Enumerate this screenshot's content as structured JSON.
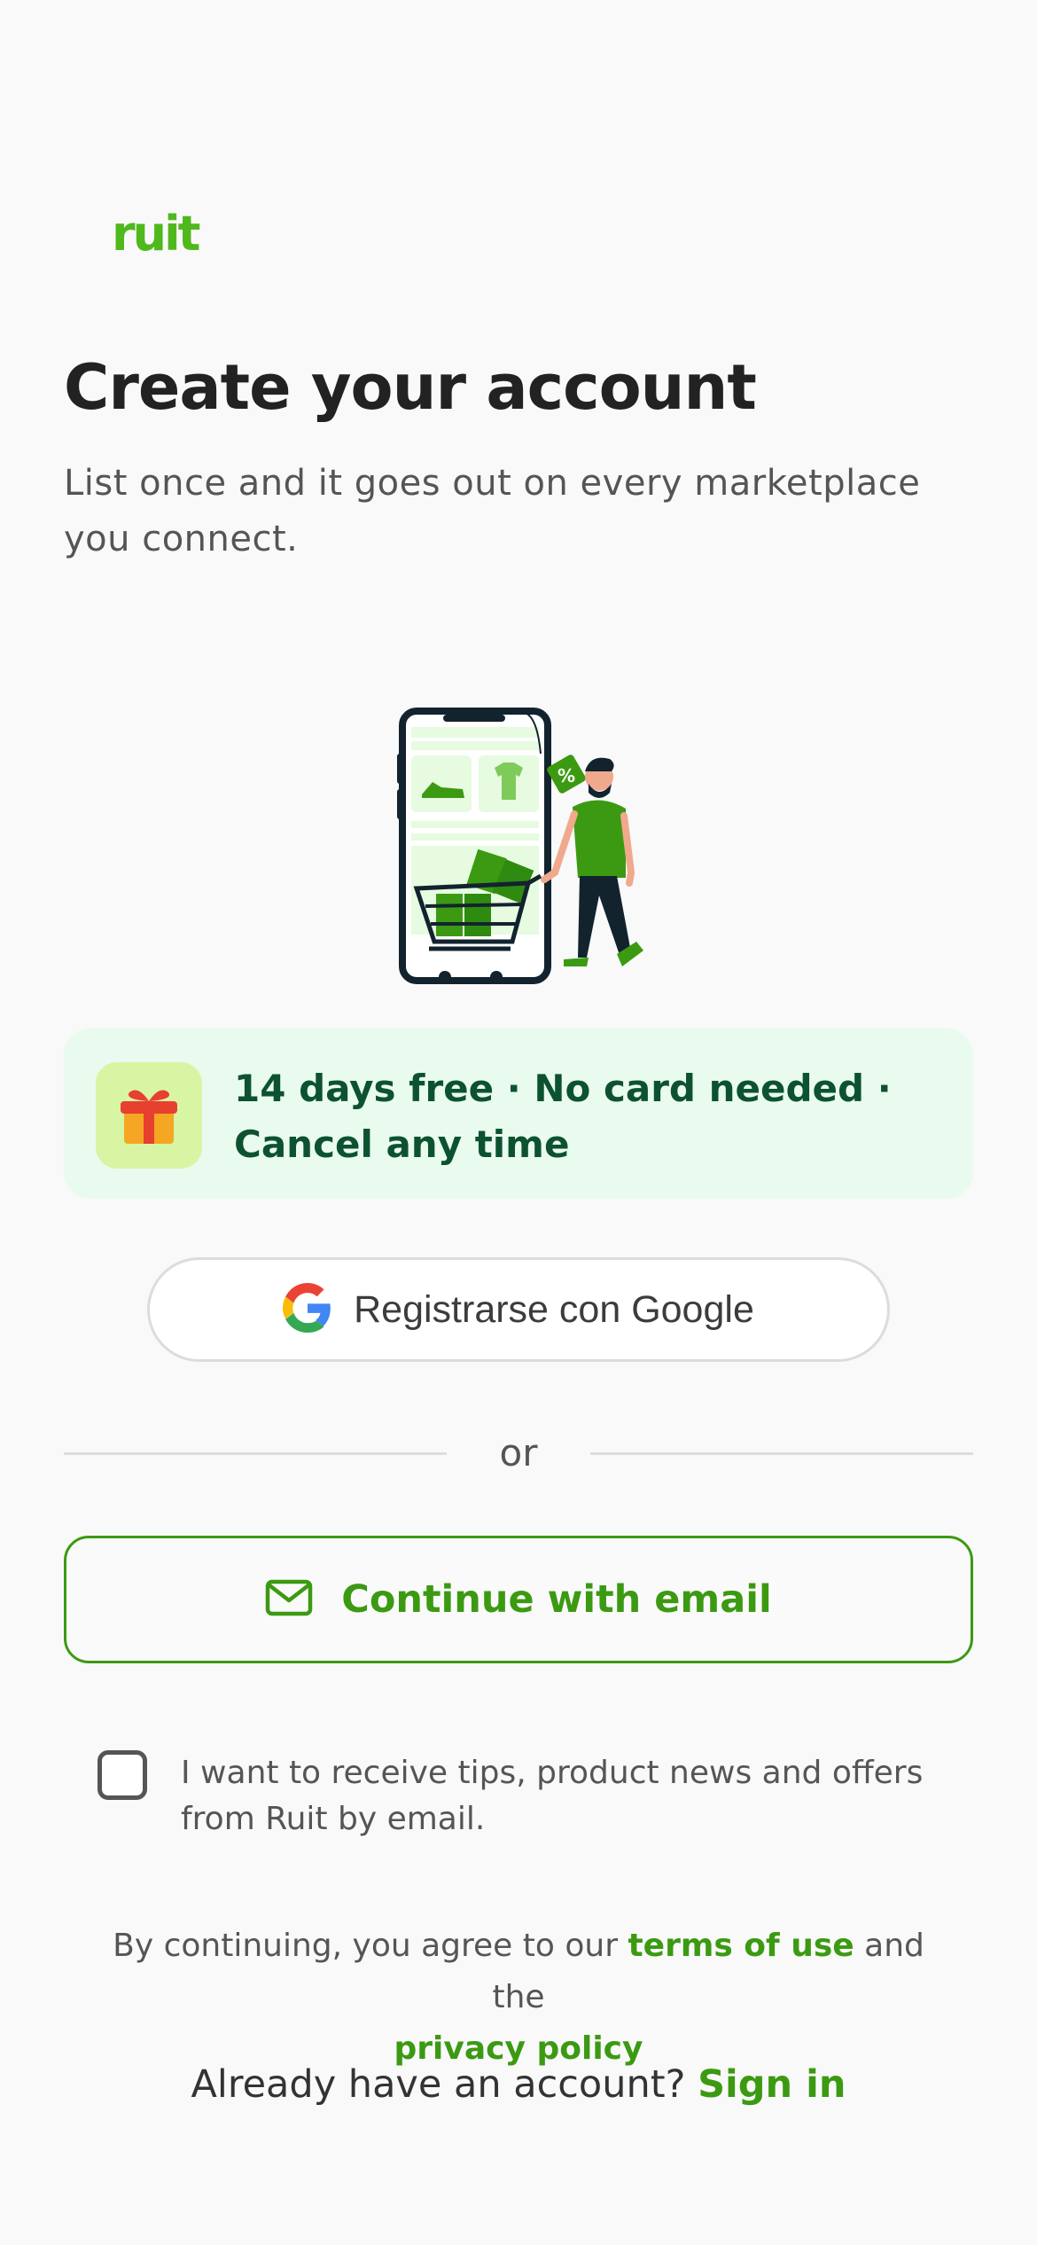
{
  "brand": {
    "logo_text": "ruit",
    "accent_color": "#3b9a12",
    "logo_color": "#4fb81c"
  },
  "header": {
    "title": "Create your account",
    "subtitle": "List once and it goes out on every marketplace you connect."
  },
  "illustration": {
    "icon": "shopping-illustration",
    "badge_text": "%"
  },
  "promo": {
    "icon": "gift-icon",
    "text": "14 days free · No card needed · Cancel any time"
  },
  "google_button": {
    "icon": "google-icon",
    "label": "Registrarse con Google"
  },
  "divider": {
    "text": "or"
  },
  "email_button": {
    "icon": "mail-icon",
    "label": "Continue with email"
  },
  "newsletter": {
    "checked": false,
    "label": "I want to receive tips, product news and offers from Ruit by email."
  },
  "legal": {
    "prefix": "By continuing, you agree to our ",
    "terms_link": "terms of use",
    "middle": " and the ",
    "privacy_link": "privacy policy"
  },
  "signin": {
    "prompt": "Already have an account? ",
    "link": "Sign in"
  }
}
